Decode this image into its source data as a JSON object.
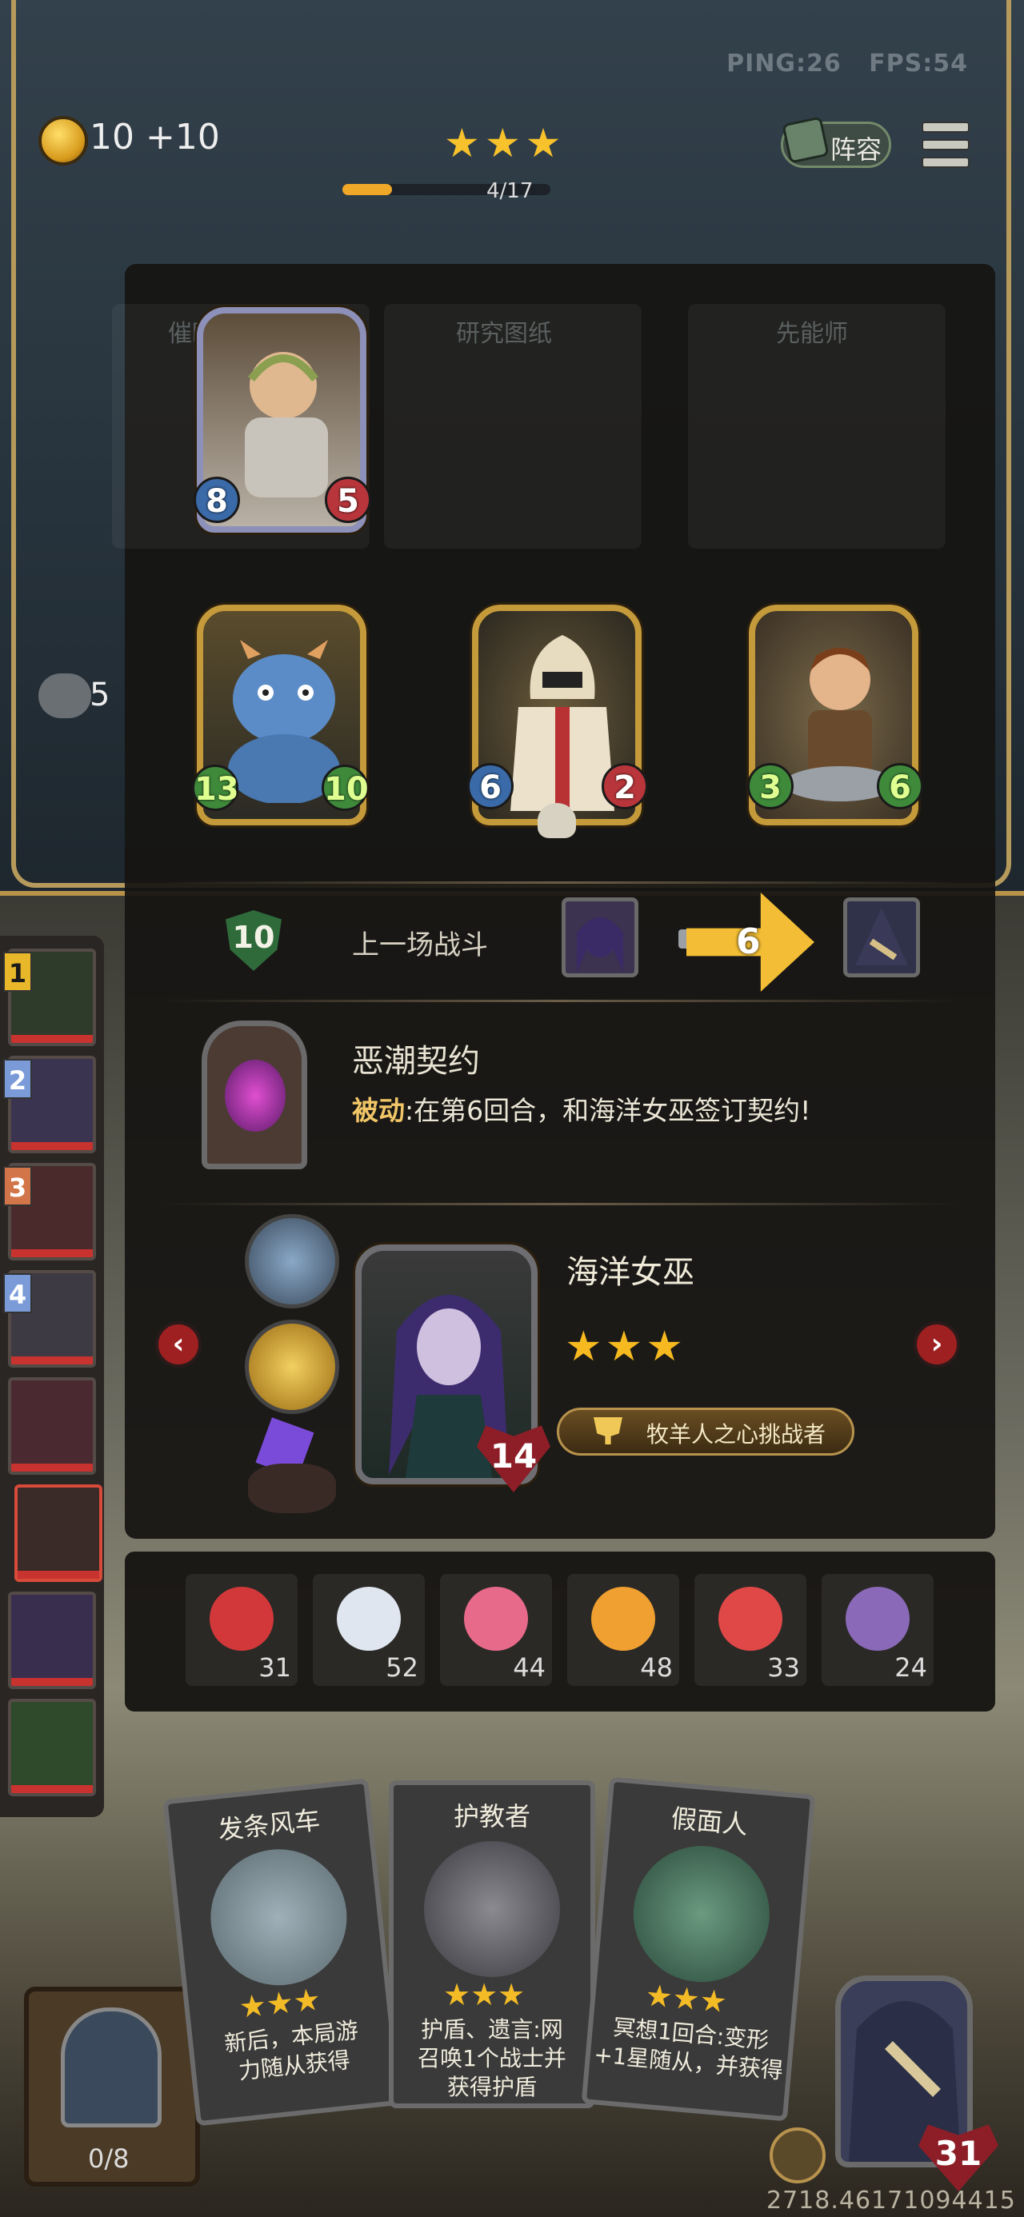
{
  "hud": {
    "ping": "PING:26",
    "fps": "FPS:54",
    "gold": "10 +10",
    "stars": "★★★",
    "turn": "4/17",
    "turn_progress": 0.24,
    "lineup_label": "阵容",
    "chat_count": "5"
  },
  "board_ghost_cards": [
    {
      "name": "催眠"
    },
    {
      "name": "研究图纸"
    },
    {
      "name": "先能师"
    }
  ],
  "shop_minions": [
    {
      "atk": "8",
      "hp": "5",
      "frame": "silver",
      "icon": "old-man-portrait"
    },
    {
      "atk": "13",
      "hp": "10",
      "frame": "gold",
      "icon": "blue-dragon-portrait"
    },
    {
      "atk": "6",
      "hp": "2",
      "frame": "gold",
      "icon": "white-knight-portrait"
    },
    {
      "atk": "3",
      "hp": "6",
      "frame": "gold",
      "icon": "blacksmith-boy-portrait"
    }
  ],
  "last_battle": {
    "tier": "10",
    "label": "上一场战斗",
    "damage": "6"
  },
  "contract": {
    "title": "恶潮契约",
    "desc_prefix": "被动",
    "desc_body": ":在第6回合，和海洋女巫签订契约!"
  },
  "boss": {
    "name": "海洋女巫",
    "stars": "★★★",
    "hp": "14",
    "trophy": "牧羊人之心挑战者"
  },
  "items": [
    {
      "icon": "alarm-clock-icon",
      "count": "31"
    },
    {
      "icon": "teacup-icon",
      "count": "52"
    },
    {
      "icon": "cupcake-icon",
      "count": "44"
    },
    {
      "icon": "rubber-chicken-icon",
      "count": "48"
    },
    {
      "icon": "clown-icon",
      "count": "33"
    },
    {
      "icon": "mirror-icon",
      "count": "24"
    }
  ],
  "roster": [
    {
      "rank": "1"
    },
    {
      "rank": "2"
    },
    {
      "rank": "3"
    },
    {
      "rank": "4"
    },
    {
      "rank": ""
    },
    {
      "rank": ""
    },
    {
      "rank": ""
    },
    {
      "rank": ""
    }
  ],
  "hand": [
    {
      "name": "发条风车",
      "stars": "★★★",
      "text_line1": "新后，本局游",
      "text_line2": "力随从获得"
    },
    {
      "name": "护教者",
      "stars": "★★★",
      "text_line1": "护盾、遗言:网",
      "text_line2": "召唤1个战士并",
      "text_line3": "获得护盾"
    },
    {
      "name": "假面人",
      "stars": "★★★",
      "text_line1": "冥想1回合:变形",
      "text_line2": "+1星随从，并获得"
    }
  ],
  "deck": {
    "count": "0/8"
  },
  "hero": {
    "hp": "31"
  },
  "footer": {
    "coords": "2718.46171094415"
  },
  "colors": {
    "gold": "#f3be35",
    "hp_red": "#b8363b",
    "atk_blue": "#3a6aa8",
    "panel": "#161412"
  }
}
